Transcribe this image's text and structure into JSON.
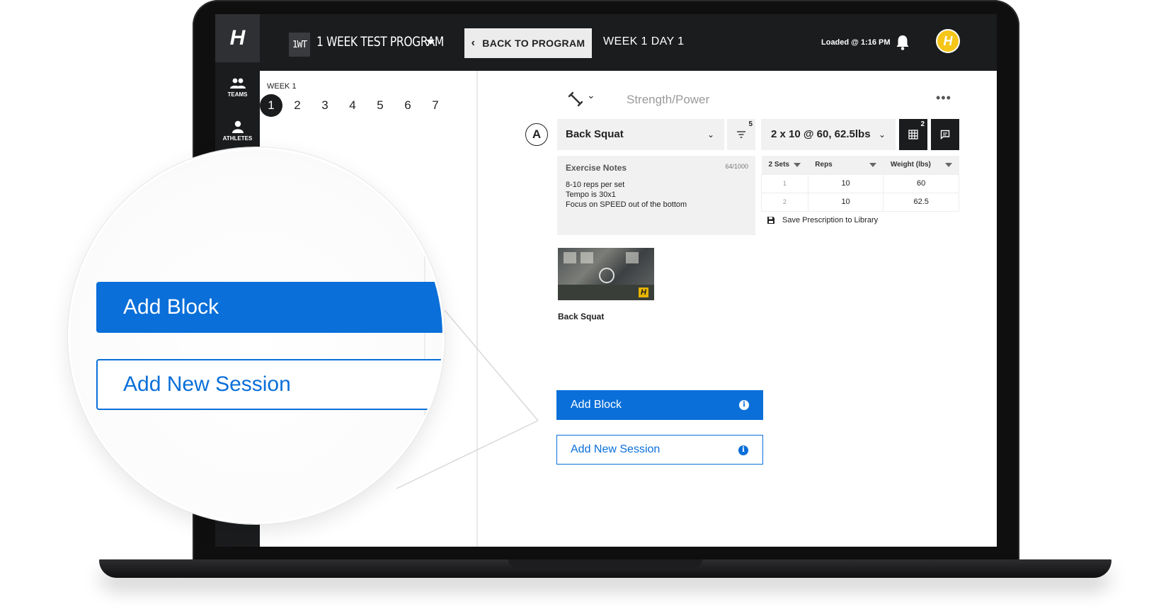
{
  "app": {
    "logo_letter": "H",
    "program_badge": "1WT",
    "program_title": "1 WEEK TEST PROGRAM",
    "back_button": "BACK TO PROGRAM",
    "week_day": "WEEK 1 DAY 1",
    "loaded_status": "Loaded @ 1:16 PM",
    "avatar_letter": "H"
  },
  "sidebar": {
    "items": [
      {
        "label": "TEAMS",
        "icon": "teams-icon"
      },
      {
        "label": "ATHLETES",
        "icon": "athlete-icon"
      }
    ]
  },
  "week_nav": {
    "label": "WEEK 1",
    "days": [
      "1",
      "2",
      "3",
      "4",
      "5",
      "6",
      "7"
    ],
    "active_day": "1"
  },
  "block": {
    "type": "Strength/Power",
    "letter": "A",
    "exercise": "Back Squat",
    "filter_count": "5",
    "prescription": "2 x 10 @ 60, 62.5lbs",
    "grid_count": "2",
    "notes_title": "Exercise Notes",
    "notes_count": "64/1000",
    "notes_body": "8-10 reps per set\nTempo is 30x1\nFocus on SPEED out of the bottom",
    "table": {
      "headers": [
        "2 Sets",
        "Reps",
        "Weight (lbs)"
      ],
      "rows": [
        {
          "idx": "1",
          "reps": "10",
          "weight": "60"
        },
        {
          "idx": "2",
          "reps": "10",
          "weight": "62.5"
        }
      ]
    },
    "save_label": "Save Prescription to Library",
    "video_label": "Back Squat"
  },
  "actions": {
    "add_block": "Add Block",
    "add_session": "Add New Session"
  },
  "colors": {
    "primary": "#0a6fd9",
    "dark": "#1b1c1e",
    "accent": "#f5c518"
  }
}
